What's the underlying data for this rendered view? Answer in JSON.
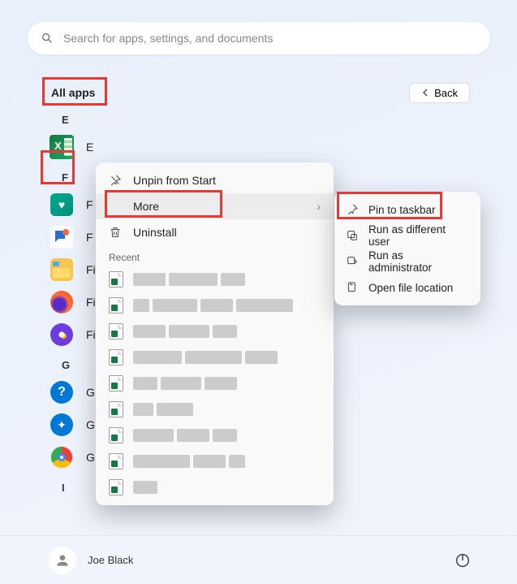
{
  "search": {
    "placeholder": "Search for apps, settings, and documents"
  },
  "header": {
    "all_apps": "All apps",
    "back": "Back"
  },
  "sections": {
    "E": "E",
    "F": "F",
    "G": "G",
    "I": "I"
  },
  "apps": {
    "excel": "E",
    "family": "F",
    "feedback": "F",
    "fileexplorer": "Fi",
    "firefox": "Fi",
    "firefoxdev": "Fi",
    "gethelp": "G",
    "gamebar": "G",
    "chrome": "G"
  },
  "ctx": {
    "unpin": "Unpin from Start",
    "more": "More",
    "uninstall": "Uninstall",
    "recent": "Recent"
  },
  "sub": {
    "pin": "Pin to taskbar",
    "diffuser": "Run as different user",
    "admin": "Run as administrator",
    "openloc": "Open file location"
  },
  "user": {
    "name": "Joe Black"
  }
}
